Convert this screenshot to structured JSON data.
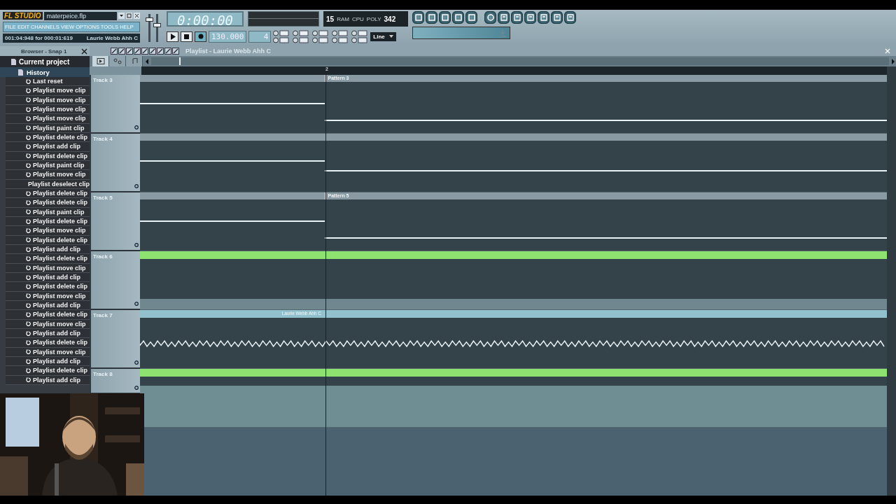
{
  "app": {
    "logo": "FL STUDIO",
    "file_name": "materpeice.flp",
    "menu": "FILE EDIT CHANNELS VIEW OPTIONS TOOLS HELP",
    "hint_time": "001:04:948 for 000:01:619",
    "hint_name": "Laurie Webb Ahh C"
  },
  "main_sliders": [
    {
      "level": 0.8
    },
    {
      "level": 0.6
    }
  ],
  "transport": {
    "time": "0:00:00",
    "tempo": "130.000",
    "pattern": "4",
    "cpu": "15",
    "poly": "342",
    "cpu_label": "CPU",
    "poly_label": "POLY",
    "ram_label": "RAM",
    "snap": "Line",
    "record": true
  },
  "browser": {
    "title": "Browser - Snap 1",
    "root": "Current project",
    "folder": "History",
    "history": [
      "Last reset",
      "Playlist move clip",
      "Playlist move clip",
      "Playlist move clip",
      "Playlist move clip",
      "Playlist paint clip",
      "Playlist delete clip",
      "Playlist add clip",
      "Playlist delete clip",
      "Playlist paint clip",
      "Playlist move clip",
      "Playlist deselect clip",
      "Playlist delete clip",
      "Playlist delete clip",
      "Playlist paint clip",
      "Playlist delete clip",
      "Playlist move clip",
      "Playlist delete clip",
      "Playlist add clip",
      "Playlist delete clip",
      "Playlist move clip",
      "Playlist add clip",
      "Playlist delete clip",
      "Playlist move clip",
      "Playlist add clip",
      "Playlist delete clip",
      "Playlist move clip",
      "Playlist add clip",
      "Playlist delete clip",
      "Playlist move clip",
      "Playlist add clip",
      "Playlist delete clip",
      "Playlist add clip"
    ]
  },
  "playlist": {
    "title": "Playlist - Laurie Webb Ahh C",
    "bar_marker": "2",
    "view_tabs": [
      {
        "selected": true
      },
      {
        "selected": false
      },
      {
        "selected": false
      }
    ],
    "tracks": [
      {
        "name": "Track 3",
        "kind": "pattern",
        "clip_label": "Pattern 3"
      },
      {
        "name": "Track 4",
        "kind": "pattern"
      },
      {
        "name": "Track 5",
        "kind": "pattern",
        "clip_label": "Pattern 5"
      },
      {
        "name": "Track 6",
        "kind": "automation"
      },
      {
        "name": "Track 7",
        "kind": "audio",
        "clip_label": "Laurie Webb Ahh C"
      },
      {
        "name": "Track 8",
        "kind": "automation"
      }
    ]
  }
}
